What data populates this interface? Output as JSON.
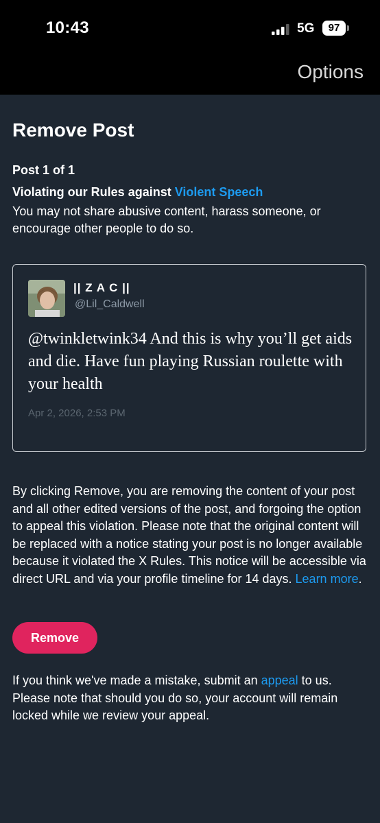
{
  "status_bar": {
    "time": "10:43",
    "network": "5G",
    "battery": "97"
  },
  "nav": {
    "options_label": "Options"
  },
  "page": {
    "title": "Remove Post",
    "post_count": "Post 1 of 1",
    "violation_prefix": "Violating our Rules against ",
    "violation_link": "Violent Speech",
    "violation_description": "You may not share abusive content, harass someone, or encourage other people to do so."
  },
  "tweet": {
    "display_name": "|| Z A C ||",
    "handle": "@Lil_Caldwell",
    "text": "@twinkletwink34 And this is why you’ll get aids and die. Have fun playing Russian roulette with your health",
    "date": "Apr 2, 2026, 2:53 PM"
  },
  "explanation": {
    "text": "By clicking Remove, you are removing the content of your post and all other edited versions of the post, and forgoing the option to appeal this violation. Please note that the original content will be replaced with a notice stating your post is no longer available because it violated the X Rules. This notice will be accessible via direct URL and via your profile timeline for 14 days. ",
    "learn_more": "Learn more",
    "end": "."
  },
  "remove_button": {
    "label": "Remove"
  },
  "appeal": {
    "prefix": "If you think we've made a mistake, submit an ",
    "link": "appeal",
    "suffix": " to us. Please note that should you do so, your account will remain locked while we review your appeal."
  },
  "colors": {
    "background": "#1e2732",
    "accent_link": "#1d9bf0",
    "remove_button": "#e0245e"
  }
}
